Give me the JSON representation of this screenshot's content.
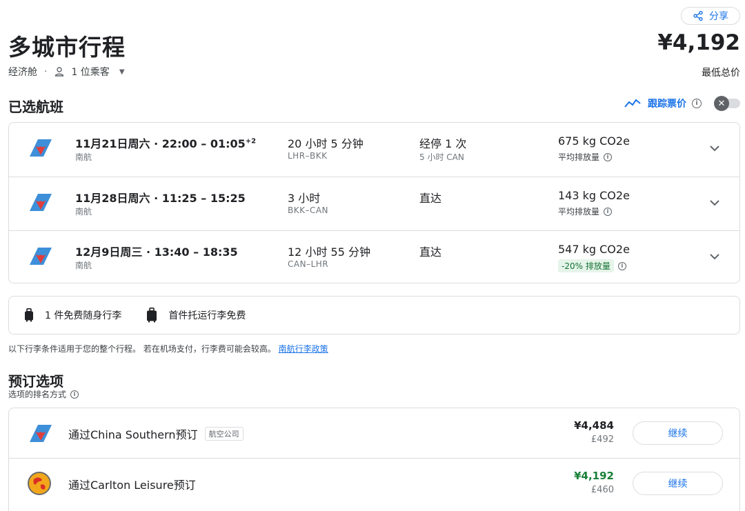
{
  "header": {
    "share_label": "分享",
    "title": "多城市行程",
    "price": "¥4,192",
    "price_label": "最低总价",
    "cabin": "经济舱",
    "passengers": "1 位乘客"
  },
  "selected": {
    "title": "已选航班",
    "track_label": "跟踪票价",
    "flights": [
      {
        "date_time": "11月21日周六 · 22:00 – 01:05",
        "plus_days": "+2",
        "airline": "南航",
        "duration": "20 小时 5 分钟",
        "route": "LHR–BKK",
        "stops": "经停 1 次",
        "stop_detail": "5 小时 CAN",
        "co2": "675 kg CO2e",
        "co2_note": "平均排放量"
      },
      {
        "date_time": "11月28日周六 · 11:25 – 15:25",
        "plus_days": "",
        "airline": "南航",
        "duration": "3 小时",
        "route": "BKK–CAN",
        "stops": "直达",
        "stop_detail": "",
        "co2": "143 kg CO2e",
        "co2_note": "平均排放量"
      },
      {
        "date_time": "12月9日周三 · 13:40 – 18:35",
        "plus_days": "",
        "airline": "南航",
        "duration": "12 小时 55 分钟",
        "route": "CAN–LHR",
        "stops": "直达",
        "stop_detail": "",
        "co2": "547 kg CO2e",
        "co2_note": "-20% 排放量"
      }
    ]
  },
  "baggage": {
    "carry_on": "1 件免费随身行李",
    "checked": "首件托运行李免费",
    "note": "以下行李条件适用于您的整个行程。 若在机场支付，行李费可能会较高。",
    "policy_link": "南航行李政策"
  },
  "booking": {
    "title": "预订选项",
    "sort_note": "选项的排名方式",
    "options": [
      {
        "name": "通过China Southern预订",
        "tag": "航空公司",
        "price": "¥4,484",
        "price_gbp": "£492",
        "button": "继续"
      },
      {
        "name": "通过Carlton Leisure预订",
        "tag": "",
        "price": "¥4,192",
        "price_gbp": "£460",
        "button": "继续"
      }
    ]
  },
  "colors": {
    "accent": "#1a73e8",
    "airline_blue": "#3d8fd9",
    "airline_red": "#e03d3d",
    "cheapest_green": "#188038"
  }
}
